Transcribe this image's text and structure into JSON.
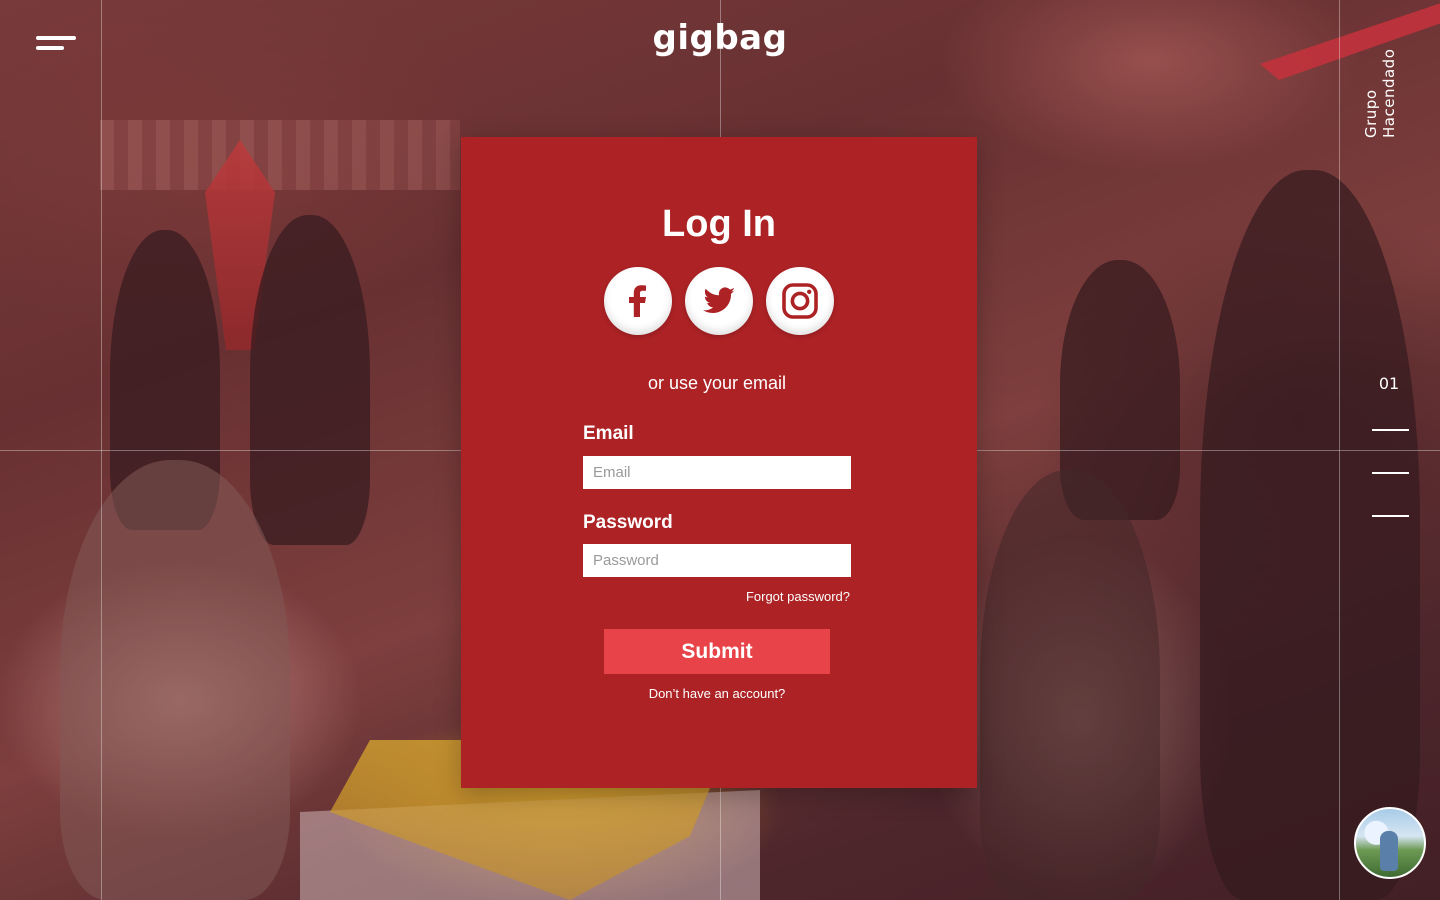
{
  "brand": {
    "logo_text": "gigbag",
    "side_label": "Grupo Hacendado"
  },
  "slider": {
    "current": "01"
  },
  "login": {
    "title": "Log In",
    "social": [
      "facebook-icon",
      "twitter-icon",
      "instagram-icon"
    ],
    "divider_text": "or use your email",
    "email_label": "Email",
    "email_placeholder": "Email",
    "password_label": "Password",
    "password_placeholder": "Password",
    "forgot_text": "Forgot password?",
    "submit_label": "Submit",
    "signup_text": "Don’t have an account?"
  },
  "colors": {
    "panel": "#ac2225",
    "submit": "#e84348",
    "text": "#ffffff"
  }
}
